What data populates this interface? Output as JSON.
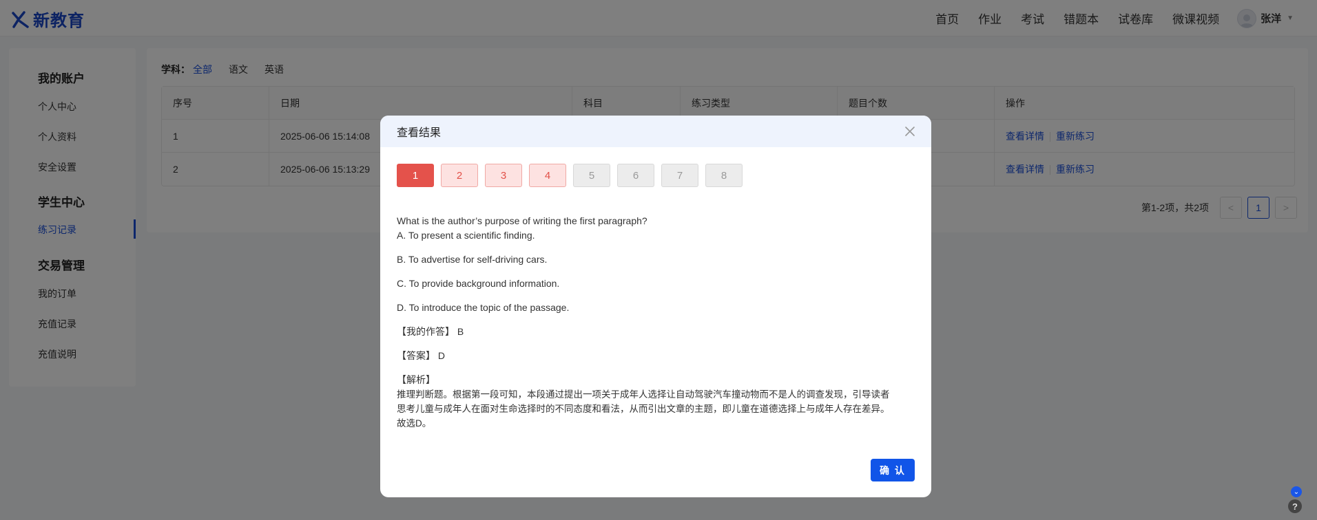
{
  "brand": {
    "logo_text": "新教育"
  },
  "nav": {
    "items": [
      "首页",
      "作业",
      "考试",
      "错题本",
      "试卷库",
      "微课视频"
    ],
    "user_name": "张洋"
  },
  "sidebar": {
    "groups": [
      {
        "title": "我的账户",
        "items": [
          "个人中心",
          "个人资料",
          "安全设置"
        ]
      },
      {
        "title": "学生中心",
        "items": [
          "练习记录"
        ]
      },
      {
        "title": "交易管理",
        "items": [
          "我的订单",
          "充值记录",
          "充值说明"
        ]
      }
    ],
    "active_item": "练习记录"
  },
  "filter": {
    "label": "学科：",
    "options": [
      "全部",
      "语文",
      "英语"
    ],
    "selected": "全部"
  },
  "table": {
    "headers": [
      "序号",
      "日期",
      "科目",
      "练习类型",
      "题目个数",
      "操作"
    ],
    "rows": [
      {
        "index": "1",
        "date": "2025-06-06 15:14:08",
        "subject": "",
        "type": "",
        "count": ""
      },
      {
        "index": "2",
        "date": "2025-06-06 15:13:29",
        "subject": "",
        "type": "",
        "count": ""
      }
    ],
    "actions": {
      "detail": "查看详情",
      "redo": "重新练习"
    }
  },
  "pager": {
    "summary": "第1-2项，共2项",
    "current": "1",
    "prev": "<",
    "next": ">"
  },
  "modal": {
    "title": "查看结果",
    "question_numbers": [
      {
        "n": "1",
        "state": "active"
      },
      {
        "n": "2",
        "state": "wrong"
      },
      {
        "n": "3",
        "state": "wrong"
      },
      {
        "n": "4",
        "state": "wrong"
      },
      {
        "n": "5",
        "state": "none"
      },
      {
        "n": "6",
        "state": "none"
      },
      {
        "n": "7",
        "state": "none"
      },
      {
        "n": "8",
        "state": "none"
      }
    ],
    "question": "What is the author’s purpose of writing the first paragraph?",
    "options": [
      "A. To present a scientific finding.",
      "B. To advertise for self-driving cars.",
      "C. To provide background information.",
      "D. To introduce the topic of the passage."
    ],
    "my_answer_label": "【我的作答】",
    "my_answer": "B",
    "answer_label": "【答案】",
    "answer": "D",
    "analysis_label": "【解析】",
    "analysis_lines": [
      "推理判断题。根据第一段可知，本段通过提出一项关于成年人选择让自动驾驶汽车撞动物而不是人的调查发现，引导读者",
      "思考儿童与成年人在面对生命选择时的不同态度和看法，从而引出文章的主题，即儿童在道德选择上与成年人存在差异。",
      "故选D。"
    ],
    "confirm_label": "确 认"
  },
  "help": {
    "icon_text": "?",
    "badge_text": "⌄"
  },
  "colors": {
    "primary": "#1b4fd8",
    "wrong": "#e4524b",
    "confirm": "#1155e8"
  }
}
